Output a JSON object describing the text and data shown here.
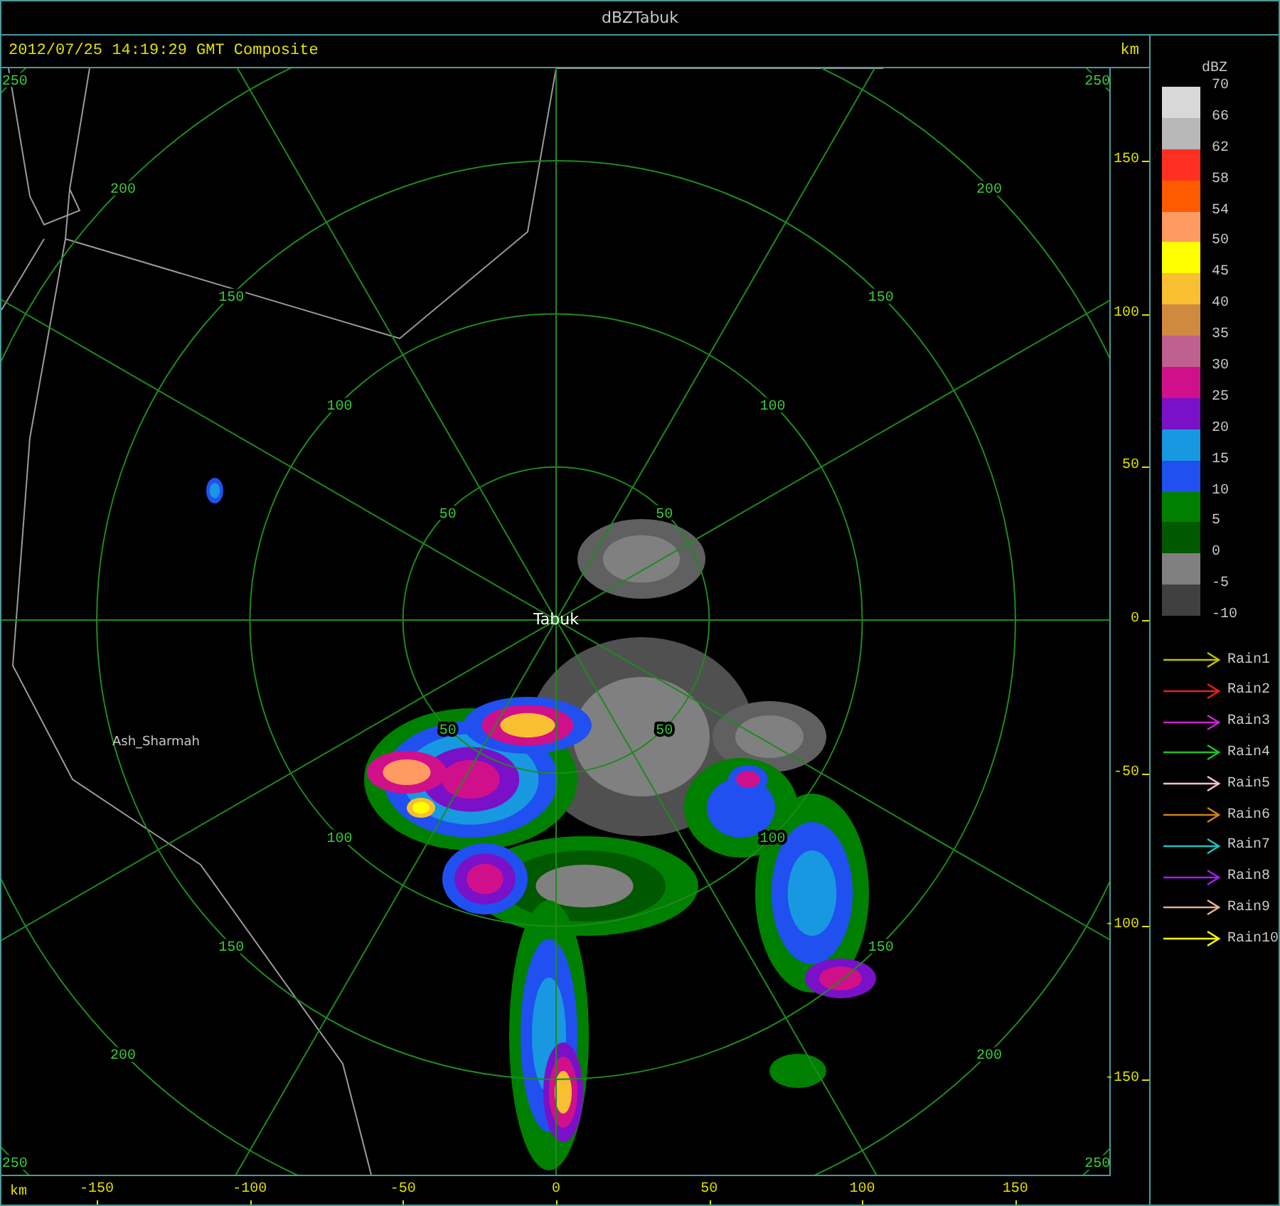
{
  "window": {
    "title": "dBZTabuk"
  },
  "header": {
    "timestamp": "2012/07/25 14:19:29 GMT Composite"
  },
  "radar": {
    "site": "Tabuk",
    "map_labels": [
      {
        "text": "Ash_Sharmah"
      }
    ],
    "rings": [
      {
        "labels": [
          "50",
          "50",
          "50",
          "50"
        ]
      },
      {
        "labels": [
          "100",
          "100",
          "100",
          "100"
        ]
      },
      {
        "labels": [
          "150",
          "150",
          "150",
          "150"
        ]
      },
      {
        "labels": [
          "200",
          "200",
          "200",
          "200"
        ]
      },
      {
        "labels": [
          "250",
          "250",
          "250",
          "250"
        ]
      }
    ]
  },
  "right_axis": {
    "unit": "km",
    "ticks": [
      "150",
      "100",
      "50",
      "0",
      "-50",
      "-100",
      "-150"
    ]
  },
  "bottom_axis": {
    "unit": "km",
    "ticks": [
      "-150",
      "-100",
      "-50",
      "0",
      "50",
      "100",
      "150"
    ]
  },
  "legend": {
    "title": "dBZ",
    "bands": [
      {
        "label": "70",
        "color": "#d8d8d8"
      },
      {
        "label": "66",
        "color": "#b8b8b8"
      },
      {
        "label": "62",
        "color": "#ff3020"
      },
      {
        "label": "58",
        "color": "#ff5a00"
      },
      {
        "label": "54",
        "color": "#ff9a60"
      },
      {
        "label": "50",
        "color": "#ffff00"
      },
      {
        "label": "45",
        "color": "#f8c030"
      },
      {
        "label": "40",
        "color": "#d08a40"
      },
      {
        "label": "35",
        "color": "#c06090"
      },
      {
        "label": "30",
        "color": "#d0108a"
      },
      {
        "label": "25",
        "color": "#7a10c8"
      },
      {
        "label": "20",
        "color": "#1898e0"
      },
      {
        "label": "15",
        "color": "#2050f0"
      },
      {
        "label": "10",
        "color": "#008000"
      },
      {
        "label": "5",
        "color": "#005800"
      },
      {
        "label": "0",
        "color": "#808080"
      },
      {
        "label": "-5",
        "color": "#404040"
      }
    ],
    "bottom_label": "-10"
  },
  "tracks": [
    {
      "label": "Rain1",
      "color": "#c0c000"
    },
    {
      "label": "Rain2",
      "color": "#e02020"
    },
    {
      "label": "Rain3",
      "color": "#d020d0"
    },
    {
      "label": "Rain4",
      "color": "#20c020"
    },
    {
      "label": "Rain5",
      "color": "#f0c0d0"
    },
    {
      "label": "Rain6",
      "color": "#d08020"
    },
    {
      "label": "Rain7",
      "color": "#20c0c0"
    },
    {
      "label": "Rain8",
      "color": "#a020f0"
    },
    {
      "label": "Rain9",
      "color": "#e0b090"
    },
    {
      "label": "Rain10",
      "color": "#ffff00"
    }
  ]
}
